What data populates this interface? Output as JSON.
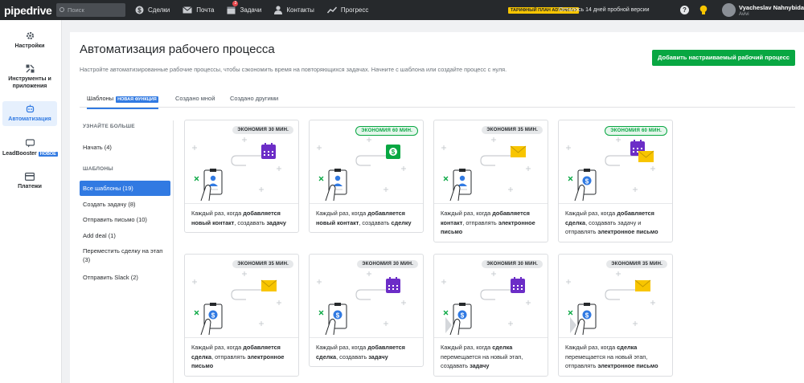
{
  "topbar": {
    "logo": "pipedrive",
    "search_placeholder": "Поиск",
    "nav": [
      {
        "label": "Сделки",
        "icon": "dollar-icon"
      },
      {
        "label": "Почта",
        "icon": "mail-icon"
      },
      {
        "label": "Задачи",
        "icon": "calendar-icon",
        "badge": "3"
      },
      {
        "label": "Контакты",
        "icon": "person-icon"
      },
      {
        "label": "Прогресс",
        "icon": "chart-icon"
      }
    ],
    "plan": "ТАРИФНЫЙ ПЛАН ADVANCED",
    "trial": "Осталось 14 дней пробной версии",
    "help": "?",
    "user_name": "Vyacheslav Nahnybida",
    "user_company": "Avivi"
  },
  "sidebar": {
    "items": [
      {
        "label": "Настройки",
        "icon": "gear-icon"
      },
      {
        "label": "Инструменты и приложения",
        "icon": "tools-icon"
      },
      {
        "label": "Автоматизация",
        "icon": "robot-icon",
        "active": true
      },
      {
        "label": "LeadBooster",
        "icon": "chat-icon",
        "badge": "НОВОЕ"
      },
      {
        "label": "Платежи",
        "icon": "card-icon"
      }
    ]
  },
  "main": {
    "title": "Автоматизация рабочего процесса",
    "subtitle": "Настройте автоматизированные рабочие процессы, чтобы сэкономить время на повторяющихся задачах. Начните с шаблона или создайте процесс с нуля.",
    "add_button": "Добавить настраиваемый рабочий процесс",
    "tabs": [
      {
        "label": "Шаблоны",
        "badge": "НОВАЯ ФУНКЦИЯ",
        "active": true
      },
      {
        "label": "Создано мной"
      },
      {
        "label": "Создано другими"
      }
    ]
  },
  "left": {
    "learn_head": "УЗНАЙТЕ БОЛЬШЕ",
    "start": "Начать (4)",
    "templates_head": "ШАБЛОНЫ",
    "items": [
      {
        "label": "Все шаблоны (19)",
        "active": true
      },
      {
        "label": "Создать задачу (8)"
      },
      {
        "label": "Отправить письмо (10)"
      },
      {
        "label": "Add deal (1)"
      },
      {
        "label": "Переместить сделку на этап (3)"
      },
      {
        "label": "Отправить Slack (2)"
      }
    ]
  },
  "colors": {
    "green": "#08a742",
    "blue": "#317ae2",
    "purple": "#6c2dc7",
    "yellow": "#f8c500"
  },
  "cards": [
    {
      "pill": "ЭКОНОМИЯ 30 МИН.",
      "green": false,
      "subject": "person",
      "action": "calendar",
      "parts": [
        "Каждый раз, когда ",
        "добавляется новый контакт",
        ", создавать ",
        "задачу"
      ]
    },
    {
      "pill": "ЭКОНОМИЯ 60 МИН.",
      "green": true,
      "subject": "person",
      "action": "deal",
      "parts": [
        "Каждый раз, когда ",
        "добавляется новый контакт",
        ", создавать ",
        "сделку"
      ]
    },
    {
      "pill": "ЭКОНОМИЯ 35 МИН.",
      "green": false,
      "subject": "person",
      "action": "mail",
      "parts": [
        "Каждый раз, когда ",
        "добавляется контакт",
        ", отправлять ",
        "электронное письмо"
      ]
    },
    {
      "pill": "ЭКОНОМИЯ 60 МИН.",
      "green": true,
      "subject": "dollar",
      "action": "calendar-mail",
      "parts": [
        "Каждый раз, когда ",
        "добавляется сделка",
        ", создавать задачу и отправлять ",
        "электронное письмо"
      ]
    },
    {
      "pill": "ЭКОНОМИЯ 35 МИН.",
      "green": false,
      "subject": "dollar",
      "action": "mail",
      "parts": [
        "Каждый раз, когда ",
        "добавляется сделка",
        ", отправлять ",
        "электронное письмо"
      ]
    },
    {
      "pill": "ЭКОНОМИЯ 30 МИН.",
      "green": false,
      "subject": "dollar",
      "action": "calendar",
      "parts": [
        "Каждый раз, когда ",
        "добавляется сделка",
        ", создавать ",
        "задачу"
      ]
    },
    {
      "pill": "ЭКОНОМИЯ 30 МИН.",
      "green": false,
      "subject": "dollar-move",
      "action": "calendar",
      "parts": [
        "Каждый раз, когда ",
        "сделка",
        " перемещается на новый этап, создавать ",
        "задачу"
      ]
    },
    {
      "pill": "ЭКОНОМИЯ 35 МИН.",
      "green": false,
      "subject": "dollar-move",
      "action": "mail",
      "parts": [
        "Каждый раз, когда ",
        "сделка",
        " перемещается на новый этап, отправлять ",
        "электронное письмо"
      ]
    }
  ]
}
